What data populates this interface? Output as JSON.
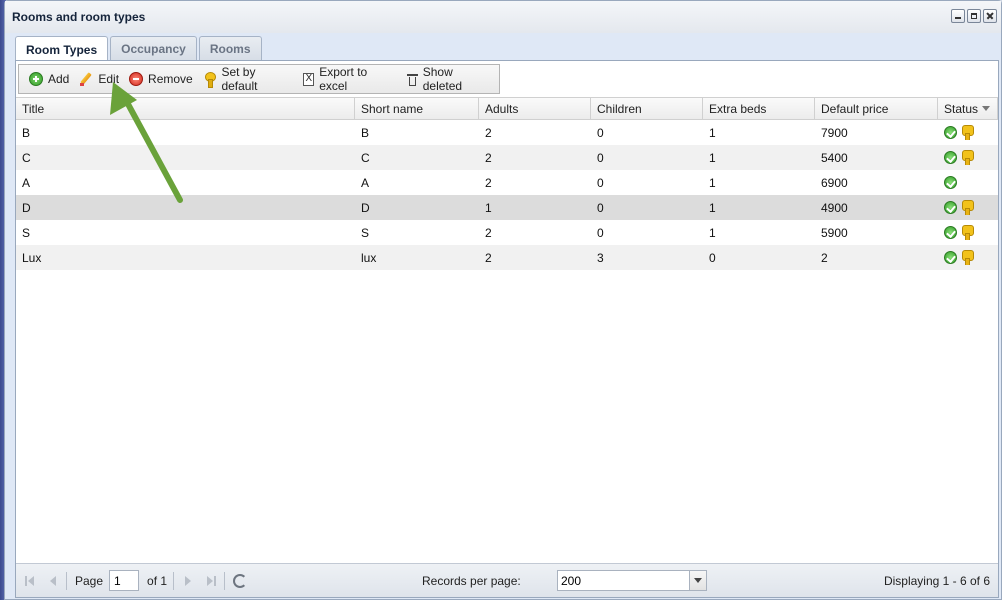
{
  "window": {
    "title": "Rooms and room types"
  },
  "tabs": [
    {
      "label": "Room Types"
    },
    {
      "label": "Occupancy"
    },
    {
      "label": "Rooms"
    }
  ],
  "toolbar": {
    "add": "Add",
    "edit": "Edit",
    "remove": "Remove",
    "set_default": "Set by default",
    "export": "Export to excel",
    "show_deleted": "Show deleted"
  },
  "grid": {
    "columns": [
      "Title",
      "Short name",
      "Adults",
      "Children",
      "Extra beds",
      "Default price",
      "Status"
    ],
    "rows": [
      {
        "title": "B",
        "short": "B",
        "adults": "2",
        "children": "0",
        "extra": "1",
        "price": "7900",
        "default": true
      },
      {
        "title": "C",
        "short": "C",
        "adults": "2",
        "children": "0",
        "extra": "1",
        "price": "5400",
        "default": true
      },
      {
        "title": "A",
        "short": "A",
        "adults": "2",
        "children": "0",
        "extra": "1",
        "price": "6900",
        "default": false
      },
      {
        "title": "D",
        "short": "D",
        "adults": "1",
        "children": "0",
        "extra": "1",
        "price": "4900",
        "default": true
      },
      {
        "title": "S",
        "short": "S",
        "adults": "2",
        "children": "0",
        "extra": "1",
        "price": "5900",
        "default": true
      },
      {
        "title": "Lux",
        "short": "lux",
        "adults": "2",
        "children": "3",
        "extra": "0",
        "price": "2",
        "default": true
      }
    ]
  },
  "pager": {
    "page_label": "Page",
    "page_value": "1",
    "of_label": "of 1",
    "records_label": "Records per page:",
    "records_value": "200",
    "display_info": "Displaying 1 - 6 of 6"
  },
  "colors": {
    "annotation_arrow": "#6aa23a"
  }
}
